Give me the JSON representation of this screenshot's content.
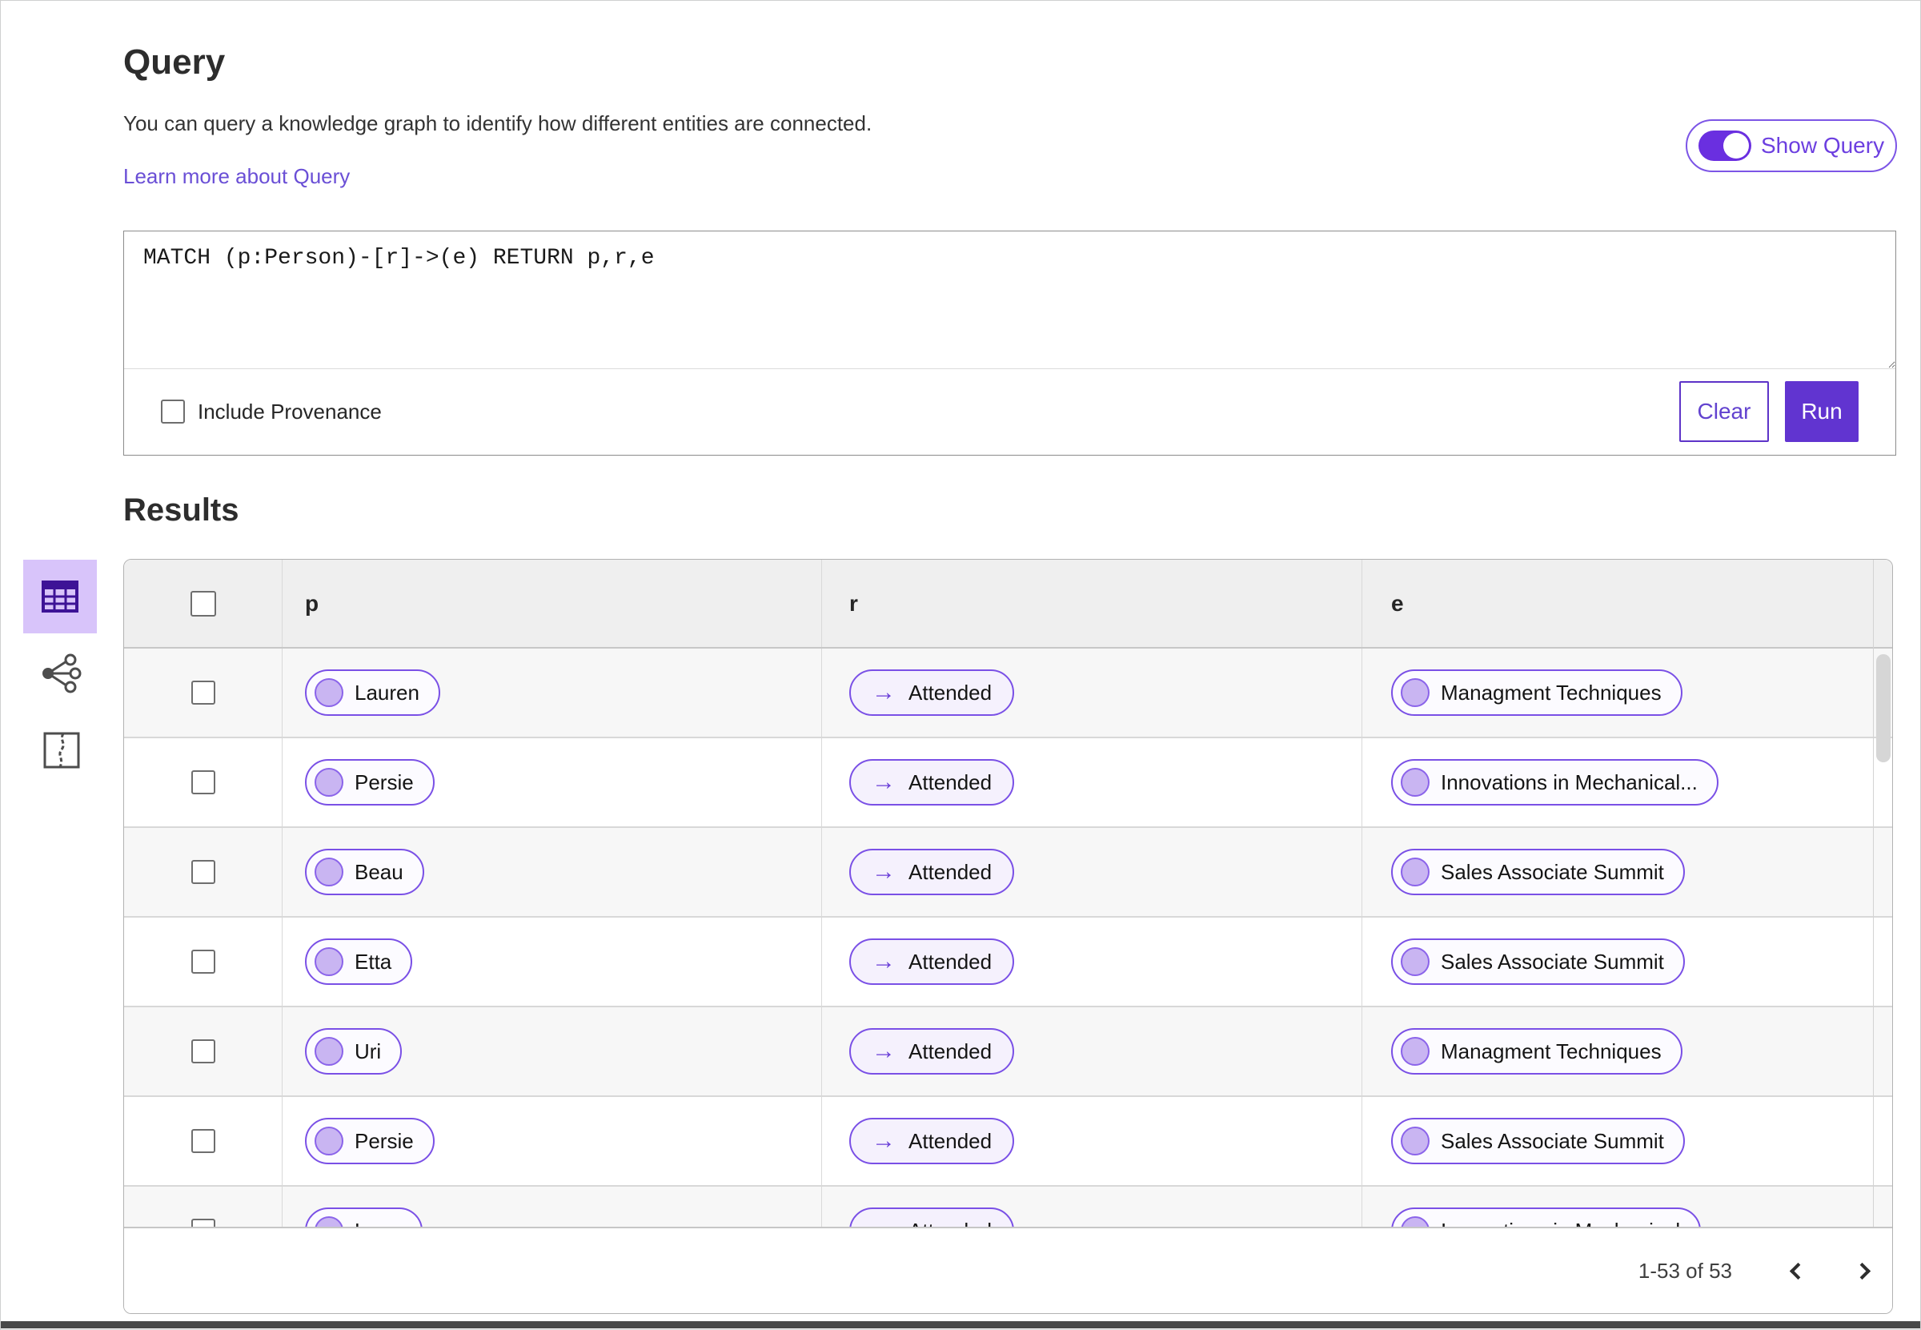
{
  "page": {
    "title": "Query",
    "description": "You can query a knowledge graph to identify how different entities are connected.",
    "learn_more": "Learn more about Query",
    "show_query_label": "Show Query",
    "query_text": "MATCH (p:Person)-[r]->(e) RETURN p,r,e",
    "include_provenance_label": "Include Provenance",
    "clear_label": "Clear",
    "run_label": "Run",
    "results_title": "Results"
  },
  "view_switcher": {
    "selected": "table-view",
    "items": [
      "table-view",
      "graph-view",
      "map-view"
    ]
  },
  "table": {
    "columns": [
      "p",
      "r",
      "e"
    ],
    "relation_arrow": "→",
    "rows": [
      {
        "p": "Lauren",
        "r": "Attended",
        "e": "Managment Techniques"
      },
      {
        "p": "Persie",
        "r": "Attended",
        "e": "Innovations in Mechanical..."
      },
      {
        "p": "Beau",
        "r": "Attended",
        "e": "Sales Associate Summit"
      },
      {
        "p": "Etta",
        "r": "Attended",
        "e": "Sales Associate Summit"
      },
      {
        "p": "Uri",
        "r": "Attended",
        "e": "Managment Techniques"
      },
      {
        "p": "Persie",
        "r": "Attended",
        "e": "Sales Associate Summit"
      },
      {
        "p": "Larry",
        "r": "Attended",
        "e": "Innovations in Mechanical"
      }
    ]
  },
  "pagination": {
    "range_label": "1-53 of 53"
  },
  "colors": {
    "accent_purple": "#6134d0",
    "pill_border": "#7a50e6",
    "pill_dot_fill": "#c9b5f2",
    "selected_tile_bg": "#d8c4fa",
    "header_row_bg": "#efefef",
    "alt_row_bg": "#f7f7f7",
    "link": "#6a4fd6"
  }
}
